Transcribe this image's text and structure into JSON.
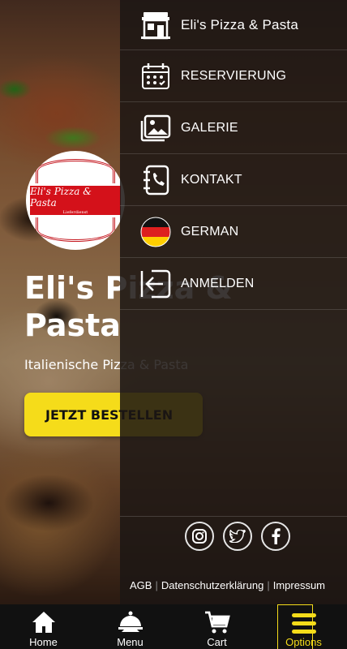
{
  "hero": {
    "logo_text": "Eli's Pizza & Pasta",
    "logo_subtext": "Lieferdienst",
    "title": "Eli's Pizza &\nPasta",
    "subtitle": "Italienische Pizza & Pasta",
    "cta_label": "JETZT BESTELLEN"
  },
  "drawer": {
    "items": [
      {
        "label": "Eli's Pizza & Pasta",
        "icon": "restaurant-icon"
      },
      {
        "label": "RESERVIERUNG",
        "icon": "calendar-icon"
      },
      {
        "label": "GALERIE",
        "icon": "gallery-icon"
      },
      {
        "label": "KONTAKT",
        "icon": "contact-book-icon"
      },
      {
        "label": "GERMAN",
        "icon": "german-flag-icon"
      },
      {
        "label": "ANMELDEN",
        "icon": "login-icon"
      }
    ],
    "social": [
      "instagram-icon",
      "twitter-icon",
      "facebook-icon"
    ],
    "footer": {
      "agb": "AGB",
      "privacy": "Datenschutzerklärung",
      "imprint": "Impressum",
      "separator": "|"
    }
  },
  "bottom_nav": [
    {
      "label": "Home",
      "icon": "home-icon"
    },
    {
      "label": "Menu",
      "icon": "dish-icon"
    },
    {
      "label": "Cart",
      "icon": "cart-icon"
    },
    {
      "label": "Options",
      "icon": "hamburger-icon",
      "active": true
    }
  ],
  "colors": {
    "accent": "#f5dc1a",
    "drawer_bg": "#1c1614",
    "nav_bg": "#111111"
  }
}
